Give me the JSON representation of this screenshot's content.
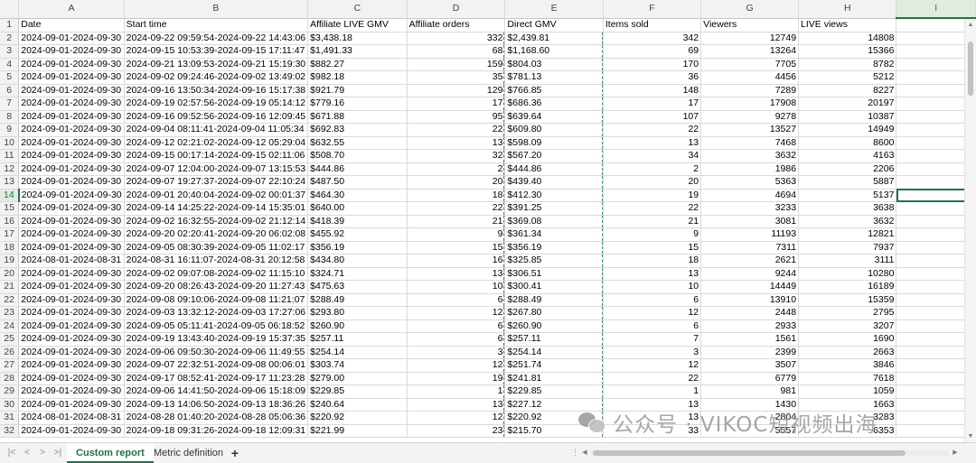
{
  "columns": [
    "A",
    "B",
    "C",
    "D",
    "E",
    "F",
    "G",
    "H",
    "I"
  ],
  "selected_column": "I",
  "selected_row": "14",
  "header_row": [
    "Date",
    "Start time",
    "Affiliate LIVE GMV",
    "Affiliate orders",
    "Direct GMV",
    "Items sold",
    "Viewers",
    "LIVE views",
    ""
  ],
  "rows": [
    [
      "2",
      "2024-09-01-2024-09-30",
      "2024-09-22 09:59:54-2024-09-22 14:43:06",
      "$3,438.18",
      "332",
      "$2,439.81",
      "342",
      "12749",
      "14808"
    ],
    [
      "3",
      "2024-09-01-2024-09-30",
      "2024-09-15 10:53:39-2024-09-15 17:11:47",
      "$1,491.33",
      "68",
      "$1,168.60",
      "69",
      "13264",
      "15366"
    ],
    [
      "4",
      "2024-09-01-2024-09-30",
      "2024-09-21 13:09:53-2024-09-21 15:19:30",
      "$882.27",
      "159",
      "$804.03",
      "170",
      "7705",
      "8782"
    ],
    [
      "5",
      "2024-09-01-2024-09-30",
      "2024-09-02 09:24:46-2024-09-02 13:49:02",
      "$982.18",
      "35",
      "$781.13",
      "36",
      "4456",
      "5212"
    ],
    [
      "6",
      "2024-09-01-2024-09-30",
      "2024-09-16 13:50:34-2024-09-16 15:17:38",
      "$921.79",
      "129",
      "$766.85",
      "148",
      "7289",
      "8227"
    ],
    [
      "7",
      "2024-09-01-2024-09-30",
      "2024-09-19 02:57:56-2024-09-19 05:14:12",
      "$779.16",
      "17",
      "$686.36",
      "17",
      "17908",
      "20197"
    ],
    [
      "8",
      "2024-09-01-2024-09-30",
      "2024-09-16 09:52:56-2024-09-16 12:09:45",
      "$671.88",
      "95",
      "$639.64",
      "107",
      "9278",
      "10387"
    ],
    [
      "9",
      "2024-09-01-2024-09-30",
      "2024-09-04 08:11:41-2024-09-04 11:05:34",
      "$692.83",
      "22",
      "$609.80",
      "22",
      "13527",
      "14949"
    ],
    [
      "10",
      "2024-09-01-2024-09-30",
      "2024-09-12 02:21:02-2024-09-12 05:29:04",
      "$632.55",
      "13",
      "$598.09",
      "13",
      "7468",
      "8600"
    ],
    [
      "11",
      "2024-09-01-2024-09-30",
      "2024-09-15 00:17:14-2024-09-15 02:11:06",
      "$508.70",
      "32",
      "$567.20",
      "34",
      "3632",
      "4163"
    ],
    [
      "12",
      "2024-09-01-2024-09-30",
      "2024-09-07 12:04:00-2024-09-07 13:15:53",
      "$444.86",
      "2",
      "$444.86",
      "2",
      "1986",
      "2206"
    ],
    [
      "13",
      "2024-09-01-2024-09-30",
      "2024-09-07 19:27:37-2024-09-07 22:10:24",
      "$487.50",
      "20",
      "$439.40",
      "20",
      "5363",
      "5887"
    ],
    [
      "14",
      "2024-09-01-2024-09-30",
      "2024-09-01 20:40:04-2024-09-02 00:01:37",
      "$464.30",
      "18",
      "$412.30",
      "19",
      "4694",
      "5137"
    ],
    [
      "15",
      "2024-09-01-2024-09-30",
      "2024-09-14 14:25:22-2024-09-14 15:35:01",
      "$640.00",
      "22",
      "$391.25",
      "22",
      "3233",
      "3638"
    ],
    [
      "16",
      "2024-09-01-2024-09-30",
      "2024-09-02 16:32:55-2024-09-02 21:12:14",
      "$418.39",
      "21",
      "$369.08",
      "21",
      "3081",
      "3632"
    ],
    [
      "17",
      "2024-09-01-2024-09-30",
      "2024-09-20 02:20:41-2024-09-20 06:02:08",
      "$455.92",
      "9",
      "$361.34",
      "9",
      "11193",
      "12821"
    ],
    [
      "18",
      "2024-09-01-2024-09-30",
      "2024-09-05 08:30:39-2024-09-05 11:02:17",
      "$356.19",
      "15",
      "$356.19",
      "15",
      "7311",
      "7937"
    ],
    [
      "19",
      "2024-08-01-2024-08-31",
      "2024-08-31 16:11:07-2024-08-31 20:12:58",
      "$434.80",
      "16",
      "$325.85",
      "18",
      "2621",
      "3111"
    ],
    [
      "20",
      "2024-09-01-2024-09-30",
      "2024-09-02 09:07:08-2024-09-02 11:15:10",
      "$324.71",
      "13",
      "$306.51",
      "13",
      "9244",
      "10280"
    ],
    [
      "21",
      "2024-09-01-2024-09-30",
      "2024-09-20 08:26:43-2024-09-20 11:27:43",
      "$475.63",
      "10",
      "$300.41",
      "10",
      "14449",
      "16189"
    ],
    [
      "22",
      "2024-09-01-2024-09-30",
      "2024-09-08 09:10:06-2024-09-08 11:21:07",
      "$288.49",
      "6",
      "$288.49",
      "6",
      "13910",
      "15359"
    ],
    [
      "23",
      "2024-09-01-2024-09-30",
      "2024-09-03 13:32:12-2024-09-03 17:27:06",
      "$293.80",
      "12",
      "$267.80",
      "12",
      "2448",
      "2795"
    ],
    [
      "24",
      "2024-09-01-2024-09-30",
      "2024-09-05 05:11:41-2024-09-05 06:18:52",
      "$260.90",
      "6",
      "$260.90",
      "6",
      "2933",
      "3207"
    ],
    [
      "25",
      "2024-09-01-2024-09-30",
      "2024-09-19 13:43:40-2024-09-19 15:37:35",
      "$257.11",
      "6",
      "$257.11",
      "7",
      "1561",
      "1690"
    ],
    [
      "26",
      "2024-09-01-2024-09-30",
      "2024-09-06 09:50:30-2024-09-06 11:49:55",
      "$254.14",
      "3",
      "$254.14",
      "3",
      "2399",
      "2663"
    ],
    [
      "27",
      "2024-09-01-2024-09-30",
      "2024-09-07 22:32:51-2024-09-08 00:06:01",
      "$303.74",
      "12",
      "$251.74",
      "12",
      "3507",
      "3846"
    ],
    [
      "28",
      "2024-09-01-2024-09-30",
      "2024-09-17 08:52:41-2024-09-17 11:23:28",
      "$279.00",
      "19",
      "$241.81",
      "22",
      "6779",
      "7618"
    ],
    [
      "29",
      "2024-09-01-2024-09-30",
      "2024-09-06 14:41:50-2024-09-06 15:18:09",
      "$229.85",
      "1",
      "$229.85",
      "1",
      "981",
      "1059"
    ],
    [
      "30",
      "2024-09-01-2024-09-30",
      "2024-09-13 14:06:50-2024-09-13 18:36:26",
      "$240.64",
      "13",
      "$227.12",
      "13",
      "1430",
      "1663"
    ],
    [
      "31",
      "2024-08-01-2024-08-31",
      "2024-08-28 01:40:20-2024-08-28 05:06:36",
      "$220.92",
      "12",
      "$220.92",
      "13",
      "2804",
      "3283"
    ],
    [
      "32",
      "2024-09-01-2024-09-30",
      "2024-09-18 09:31:26-2024-09-18 12:09:31",
      "$221.99",
      "23",
      "$215.70",
      "33",
      "5557",
      "6353"
    ]
  ],
  "sheet_tabs": [
    {
      "label": "Custom report",
      "active": true
    },
    {
      "label": "Metric definition",
      "active": false
    }
  ],
  "add_sheet_label": "+",
  "nav_icons": [
    "first-sheet-icon",
    "prev-sheet-icon",
    "next-sheet-icon",
    "last-sheet-icon"
  ],
  "watermark_text": "公众号 · VIKOC短视频出海",
  "colors": {
    "accent": "#217346",
    "header_bg": "#f2f2f2",
    "grid": "#dadada"
  }
}
